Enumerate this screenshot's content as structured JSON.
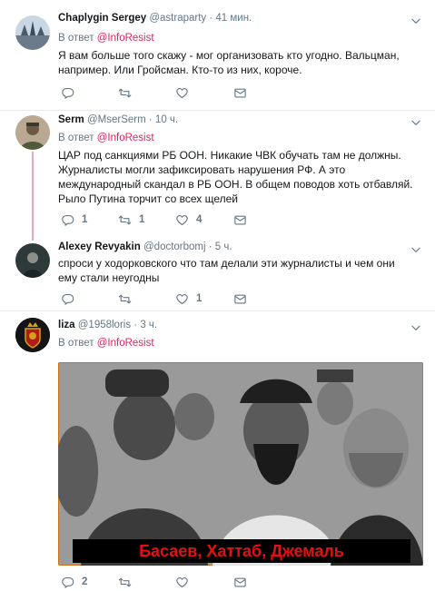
{
  "tweets": [
    {
      "name": "Chaplygin Sergey",
      "handle": "@astraparty",
      "time": "· 41 мин.",
      "reply_prefix": "В ответ",
      "reply_to": "@InfoResist",
      "text": "Я вам больше того скажу - мог организовать кто угодно. Вальцман, например. Или Гройсман. Кто-то из них, короче.",
      "counts": {
        "reply": "",
        "retweet": "",
        "like": ""
      }
    },
    {
      "name": "Serm",
      "handle": "@MserSerm",
      "time": "· 10 ч.",
      "reply_prefix": "В ответ",
      "reply_to": "@InfoResist",
      "text": "ЦАР под санкциями РБ ООН. Никакие ЧВК обучать там не должны. Журналисты могли зафиксировать нарушения РФ. А это международный скандал в РБ ООН. В общем поводов хоть отбавляй. Рыло Путина торчит со всех щелей",
      "counts": {
        "reply": "1",
        "retweet": "1",
        "like": "4"
      }
    },
    {
      "name": "Alexey Revyakin",
      "handle": "@doctorbomj",
      "time": "· 5 ч.",
      "text": "спроси у ходорковского что там делали эти журналисты и чем они ему стали неугодны",
      "counts": {
        "reply": "",
        "retweet": "",
        "like": "1"
      }
    },
    {
      "name": "liza",
      "handle": "@1958loris",
      "time": "· 3 ч.",
      "reply_prefix": "В ответ",
      "reply_to": "@InfoResist",
      "media_caption": "Басаев, Хаттаб, Джемаль",
      "counts": {
        "reply": "2",
        "retweet": "",
        "like": ""
      }
    }
  ],
  "colors": {
    "link": "#e0245e",
    "muted": "#657786",
    "thread_line": "#e8a3c3",
    "separator": "#e6ecf0"
  },
  "icons": [
    "chevron-down-icon",
    "reply-icon",
    "retweet-icon",
    "like-icon",
    "dm-icon"
  ]
}
